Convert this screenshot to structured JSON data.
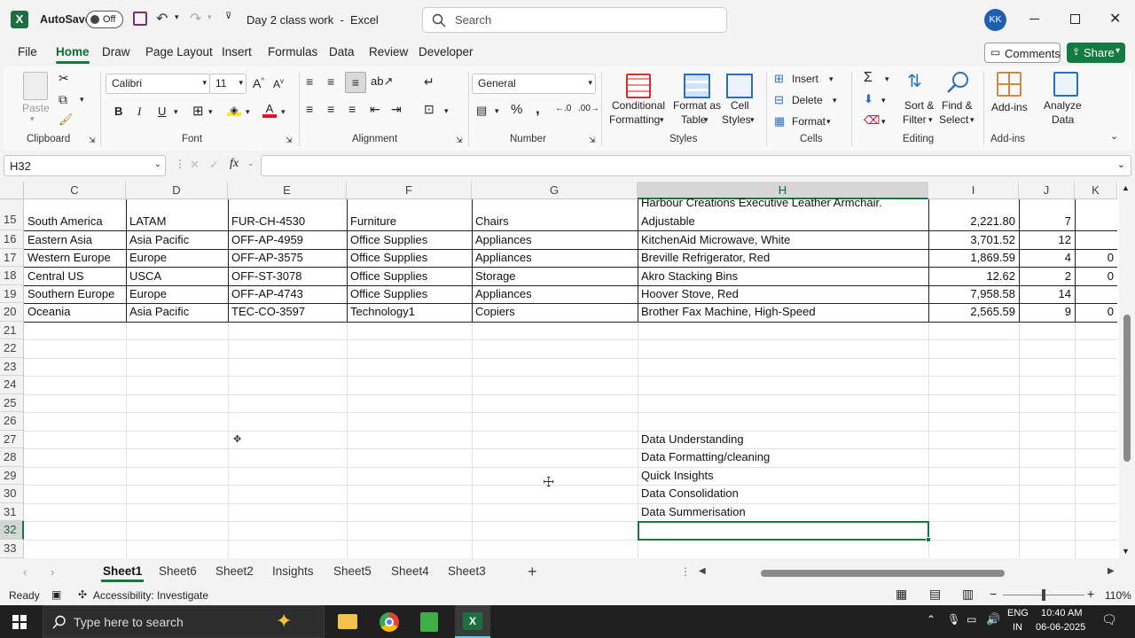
{
  "titlebar": {
    "autosave_label": "AutoSave",
    "autosave_state": "Off",
    "doc_title": "Day 2 class work  -  Excel",
    "search_placeholder": "Search",
    "user_initials": "KK"
  },
  "menu": {
    "items": [
      "File",
      "Home",
      "Draw",
      "Page Layout",
      "Insert",
      "Formulas",
      "Data",
      "Review",
      "Developer"
    ],
    "active": "Home",
    "comments_label": "Comments",
    "share_label": "Share"
  },
  "ribbon": {
    "clipboard": {
      "paste_label": "Paste",
      "group_label": "Clipboard"
    },
    "font": {
      "font_name": "Calibri",
      "font_size": "11",
      "group_label": "Font",
      "bold": "B",
      "italic": "I",
      "underline": "U"
    },
    "alignment": {
      "group_label": "Alignment"
    },
    "number": {
      "format": "General",
      "group_label": "Number"
    },
    "styles": {
      "conditional_line1": "Conditional",
      "conditional_line2": "Formatting",
      "format_table_line1": "Format as",
      "format_table_line2": "Table",
      "cell_styles_line1": "Cell",
      "cell_styles_line2": "Styles",
      "group_label": "Styles"
    },
    "cells": {
      "insert_label": "Insert",
      "delete_label": "Delete",
      "format_label": "Format",
      "group_label": "Cells"
    },
    "editing": {
      "sort_line1": "Sort &",
      "sort_line2": "Filter",
      "find_line1": "Find &",
      "find_line2": "Select",
      "group_label": "Editing"
    },
    "addins": {
      "addins_label": "Add-ins",
      "analyze_line1": "Analyze",
      "analyze_line2": "Data",
      "group_label": "Add-ins"
    }
  },
  "formula_bar": {
    "name_box": "H32",
    "fx": "fx",
    "content": ""
  },
  "columns": [
    "C",
    "D",
    "E",
    "F",
    "G",
    "H",
    "I",
    "J",
    "K"
  ],
  "rows": [
    {
      "num": "15",
      "C": "South America",
      "D": "LATAM",
      "E": "FUR-CH-4530",
      "F": "Furniture",
      "G": "Chairs",
      "H1": "Harbour Creations Executive Leather Armchair,",
      "H": "Adjustable",
      "I": "2,221.80",
      "J": "7",
      "K": ""
    },
    {
      "num": "16",
      "C": "Eastern Asia",
      "D": "Asia Pacific",
      "E": "OFF-AP-4959",
      "F": "Office Supplies",
      "G": "Appliances",
      "H": "KitchenAid Microwave, White",
      "I": "3,701.52",
      "J": "12",
      "K": ""
    },
    {
      "num": "17",
      "C": "Western Europe",
      "D": "Europe",
      "E": "OFF-AP-3575",
      "F": "Office Supplies",
      "G": "Appliances",
      "H": "Breville Refrigerator, Red",
      "I": "1,869.59",
      "J": "4",
      "K": "0"
    },
    {
      "num": "18",
      "C": "Central US",
      "D": "USCA",
      "E": "OFF-ST-3078",
      "F": "Office Supplies",
      "G": "Storage",
      "H": "Akro Stacking Bins",
      "I": "12.62",
      "J": "2",
      "K": "0"
    },
    {
      "num": "19",
      "C": "Southern Europe",
      "D": "Europe",
      "E": "OFF-AP-4743",
      "F": "Office Supplies",
      "G": "Appliances",
      "H": "Hoover Stove, Red",
      "I": "7,958.58",
      "J": "14",
      "K": ""
    },
    {
      "num": "20",
      "C": "Oceania",
      "D": "Asia Pacific",
      "E": "TEC-CO-3597",
      "F": "Technology1",
      "G": "Copiers",
      "H": "Brother Fax Machine, High-Speed",
      "I": "2,565.59",
      "J": "9",
      "K": "0"
    }
  ],
  "empty_rows": [
    "21",
    "22",
    "23",
    "24",
    "25",
    "26",
    "27",
    "28",
    "29",
    "30",
    "31",
    "32",
    "33"
  ],
  "notes": [
    "Data Understanding",
    "Data Formatting/cleaning",
    "Quick Insights",
    "Data Consolidation",
    "Data Summerisation"
  ],
  "sheets": {
    "tabs": [
      "Sheet1",
      "Sheet6",
      "Sheet2",
      "Insights",
      "Sheet5",
      "Sheet4",
      "Sheet3"
    ],
    "active": "Sheet1"
  },
  "status": {
    "ready": "Ready",
    "accessibility": "Accessibility: Investigate",
    "zoom": "110%"
  },
  "taskbar": {
    "search_placeholder": "Type here to search",
    "lang_line1": "ENG",
    "lang_line2": "IN",
    "time": "10:40 AM",
    "date": "06-06-2025"
  },
  "colors": {
    "excel_green": "#137a40",
    "taskbar": "#202020"
  }
}
